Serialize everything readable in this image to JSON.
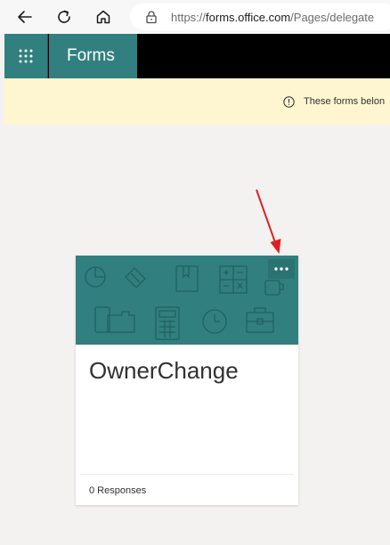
{
  "browser": {
    "url_prefix": "https://",
    "url_host": "forms.office.com",
    "url_path": "/Pages/delegate",
    "icons": [
      "back-icon",
      "refresh-icon",
      "home-icon",
      "lock-icon"
    ]
  },
  "header": {
    "app_title": "Forms",
    "waffle_icon": "app-launcher-icon",
    "accent_color": "#31807f",
    "bar_color": "#000000"
  },
  "notice": {
    "icon": "info-icon",
    "text": "These forms belon",
    "background": "#fdf6d0"
  },
  "form_card": {
    "title": "OwnerChange",
    "responses": "0 Responses",
    "more_icon": "ellipsis-icon",
    "banner_color": "#31807f"
  },
  "annotation": {
    "arrow_color": "#e02020"
  }
}
